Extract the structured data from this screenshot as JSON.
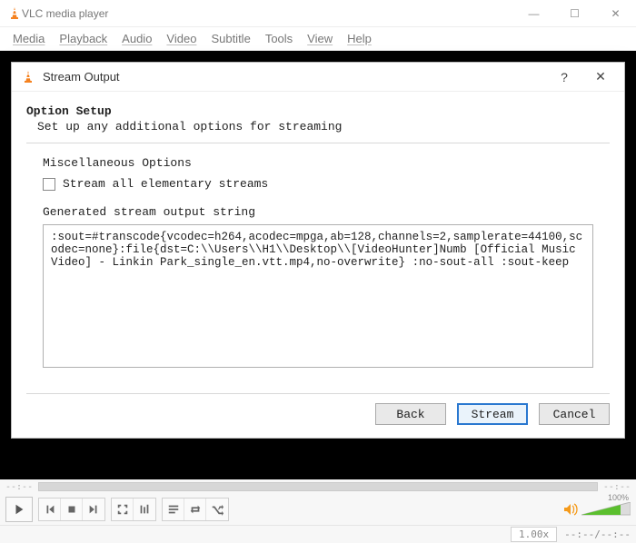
{
  "window": {
    "title": "VLC media player",
    "win_controls": {
      "min": "—",
      "max": "☐",
      "close": "✕"
    }
  },
  "menubar": [
    "Media",
    "Playback",
    "Audio",
    "Video",
    "Subtitle",
    "Tools",
    "View",
    "Help"
  ],
  "dialog": {
    "title": "Stream Output",
    "help": "?",
    "close": "✕",
    "heading": "Option Setup",
    "subheading": "Set up any additional options for streaming",
    "misc_label": "Miscellaneous Options",
    "stream_all_label": "Stream all elementary streams",
    "stream_all_checked": false,
    "generated_label": "Generated stream output string",
    "generated_value": ":sout=#transcode{vcodec=h264,acodec=mpga,ab=128,channels=2,samplerate=44100,scodec=none}:file{dst=C:\\\\Users\\\\H1\\\\Desktop\\\\[VideoHunter]Numb [Official Music Video] - Linkin Park_single_en.vtt.mp4,no-overwrite} :no-sout-all :sout-keep",
    "buttons": {
      "back": "Back",
      "stream": "Stream",
      "cancel": "Cancel"
    }
  },
  "seek": {
    "time_label": "--:--"
  },
  "controls": {
    "icons": {
      "play": "play-icon",
      "prev": "prev-icon",
      "stop": "stop-icon",
      "next": "next-icon",
      "fullscreen": "fullscreen-icon",
      "ext": "equalizer-icon",
      "playlist": "playlist-icon",
      "loop": "loop-icon",
      "shuffle": "shuffle-icon"
    },
    "volume_pct": "100%",
    "speaker_icon": "speaker-icon"
  },
  "status": {
    "speed": "1.00x",
    "time": "--:--/--:--"
  },
  "colors": {
    "accent": "#2a78d0",
    "vol_green": "#5bbf2e"
  }
}
